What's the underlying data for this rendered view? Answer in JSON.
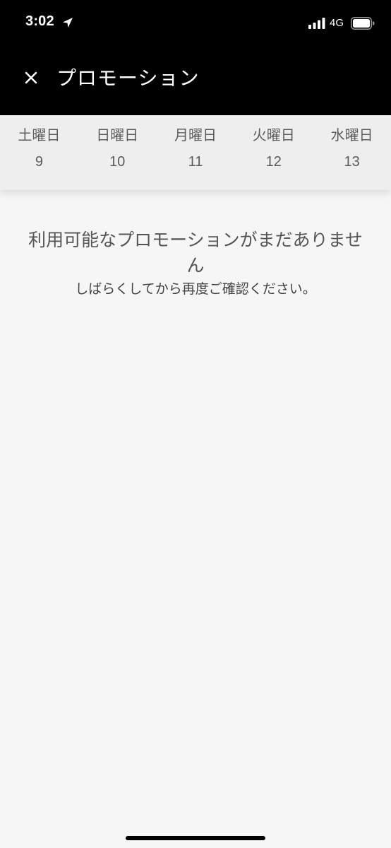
{
  "status_bar": {
    "time": "3:02",
    "network": "4G",
    "icons": [
      "location-arrow-icon",
      "cellular-signal-icon",
      "battery-icon"
    ]
  },
  "header": {
    "close_icon": "×",
    "title": "プロモーション"
  },
  "days": [
    {
      "weekday": "土曜日",
      "date": "9"
    },
    {
      "weekday": "日曜日",
      "date": "10"
    },
    {
      "weekday": "月曜日",
      "date": "11"
    },
    {
      "weekday": "火曜日",
      "date": "12"
    },
    {
      "weekday": "水曜日",
      "date": "13"
    }
  ],
  "empty_state": {
    "title": "利用可能なプロモーションがまだありません",
    "subtitle": "しばらくしてから再度ご確認ください。"
  },
  "colors": {
    "header_bg": "#000000",
    "day_strip_bg": "#eeeeee",
    "page_bg": "#f6f6f6",
    "text_muted": "#5c5c5c"
  }
}
